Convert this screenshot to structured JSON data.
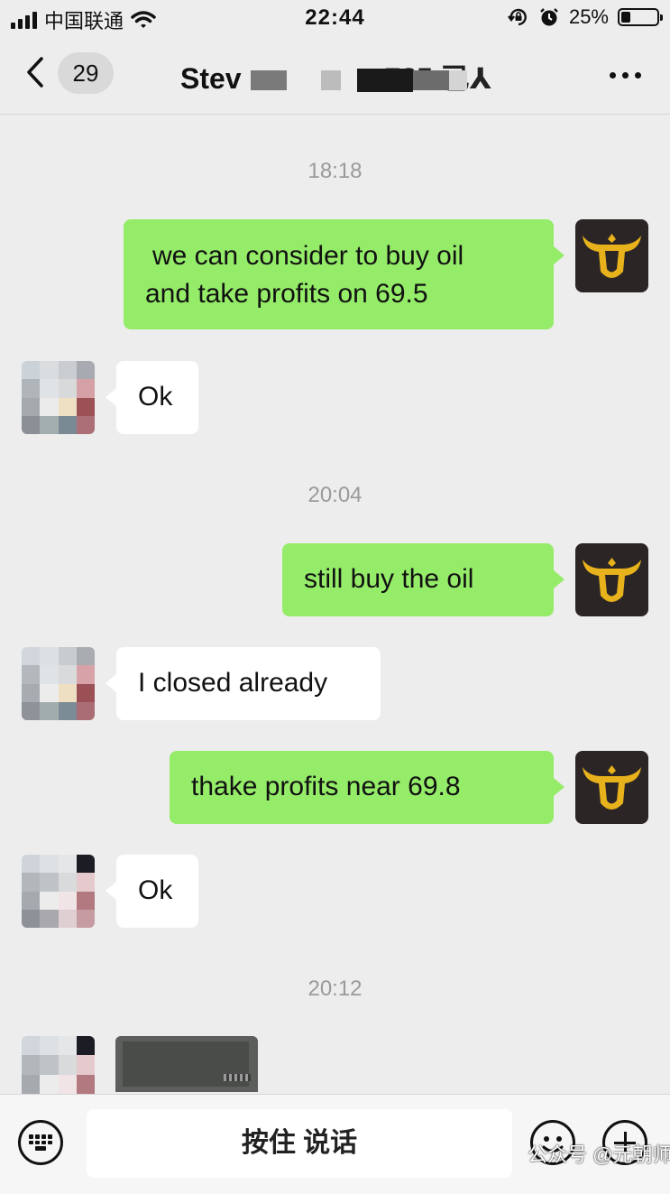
{
  "status_bar": {
    "carrier": "中国联通",
    "time": "22:44",
    "battery": "25%",
    "battery_level": 0.25,
    "icons": [
      "signal-icon",
      "wifi-icon",
      "rotation-lock-icon",
      "alarm-icon",
      "battery-icon"
    ]
  },
  "nav": {
    "unread_count": "29",
    "contact_name": "Stev",
    "contact_name_suffix": "725 已⅄",
    "icons": [
      "back-chevron-icon",
      "more-icon"
    ]
  },
  "messages": [
    {
      "type": "timestamp",
      "text": "18:18"
    },
    {
      "type": "sent",
      "lines": [
        "we can consider to buy oil",
        "and  take profits  on 69.5"
      ]
    },
    {
      "type": "received",
      "text": "Ok"
    },
    {
      "type": "timestamp",
      "text": "20:04"
    },
    {
      "type": "sent",
      "text": "still  buy  the oil"
    },
    {
      "type": "received",
      "text": "I closed already"
    },
    {
      "type": "sent",
      "text": "thake profits   near   69.8"
    },
    {
      "type": "received",
      "text": "Ok"
    },
    {
      "type": "timestamp",
      "text": "20:12"
    },
    {
      "type": "received-image"
    }
  ],
  "input_bar": {
    "hold_to_talk": "按住 说话",
    "icons": [
      "keyboard-icon",
      "emoji-icon",
      "plus-icon"
    ]
  },
  "watermark": "公众号 @元朝师兄",
  "colors": {
    "background": "#ededed",
    "sent_bubble": "#95ec69",
    "received_bubble": "#ffffff",
    "timestamp": "#9a9a9a",
    "avatar_gold": "#e8b21c"
  }
}
